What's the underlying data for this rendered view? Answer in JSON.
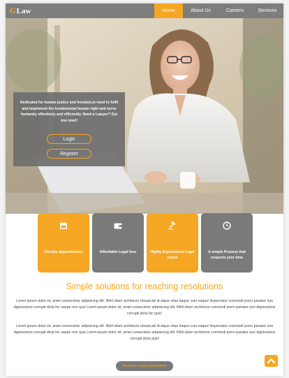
{
  "nav": {
    "logo_mark": "G",
    "logo_text": "Law",
    "links": [
      {
        "label": "Home",
        "active": true
      },
      {
        "label": "About Us",
        "active": false
      },
      {
        "label": "Careers",
        "active": false
      },
      {
        "label": "Services",
        "active": false
      }
    ]
  },
  "hero": {
    "text": "Dedicated for human justice and freedom,in need to fulfil and implement the fundamental human right and serve humanity effectively and efficiently. Need a Lawyer? Get one now!!",
    "login_label": "Login",
    "register_label": "Register"
  },
  "features": [
    {
      "label": "Flexible Appointments",
      "icon": "calendar-icon",
      "color": "orange"
    },
    {
      "label": "Affordable Legal fees",
      "icon": "wallet-icon",
      "color": "grey"
    },
    {
      "label": "Highly Experienced Legal teams",
      "icon": "gavel-icon",
      "color": "orange"
    },
    {
      "label": "A simple Process that respects your time",
      "icon": "clock-icon",
      "color": "grey"
    }
  ],
  "content": {
    "heading": "Simple solutions for reaching resolutions",
    "para1": "Lorem ipsum dolor sit, amet consectetur adipisicing elit. Nihil ullam architecto obcaecati id atque vitae itaque cum eaque! Aspernatur commodi porro pariatur iure dignissimos corrupti dicta hic saepe non quis Lorem ipsum dolor sit, amet consectetur adipisicing elit. Nihil ullam architecto commodi porro pariatur iure dignissimos corrupti dicta hic quis!",
    "para2": "Lorem ipsum dolor sit, amet consectetur adipisicing elit. Nihil ullam architecto obcaecati id atque vitae itaque cum eaque! Aspernatur commodi porro pariatur iure dignissimos corrupti dicta hic saepe non quis Lorem ipsum dolor sit, amet consectetur adipisicing elit. Nihil ullam architecto commodi porro pariatur iure dignissimos corrupti dicta quis!",
    "cta_label": "Request a case assessment"
  },
  "colors": {
    "accent": "#f5a623",
    "grey": "#7a7a7a",
    "nav_bg": "#7d7d7d"
  }
}
